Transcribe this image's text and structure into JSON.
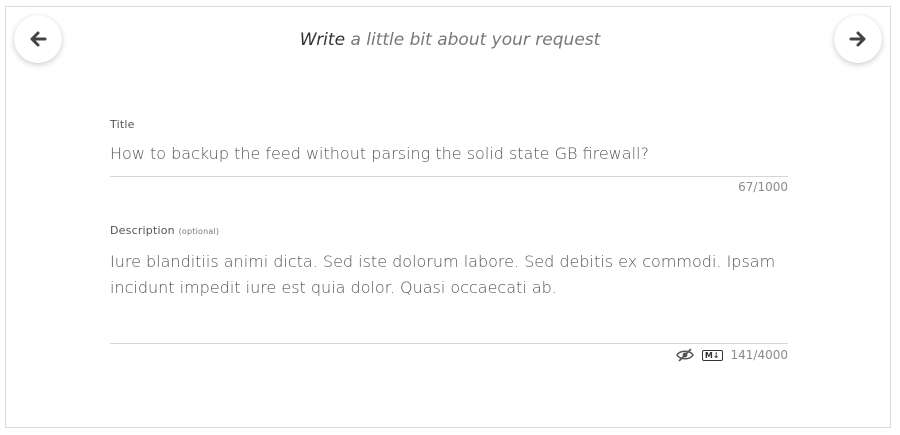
{
  "nav": {
    "prev_icon": "arrow-left-icon",
    "next_icon": "arrow-right-icon"
  },
  "header": {
    "emphasis": "Write",
    "rest": " a little bit about your request"
  },
  "title_field": {
    "label": "Title",
    "value": "How to backup the feed without parsing the solid state GB firewall?",
    "counter": "67/1000"
  },
  "description_field": {
    "label": "Description",
    "optional": "(optional)",
    "value": "Iure blanditiis animi dicta. Sed iste dolorum labore. Sed debitis ex commodi. Ipsam incidunt impedit iure est quia dolor. Quasi occaecati ab.",
    "counter": "141/4000",
    "preview_icon": "eye-slash-icon",
    "markdown_badge": "M↓"
  }
}
